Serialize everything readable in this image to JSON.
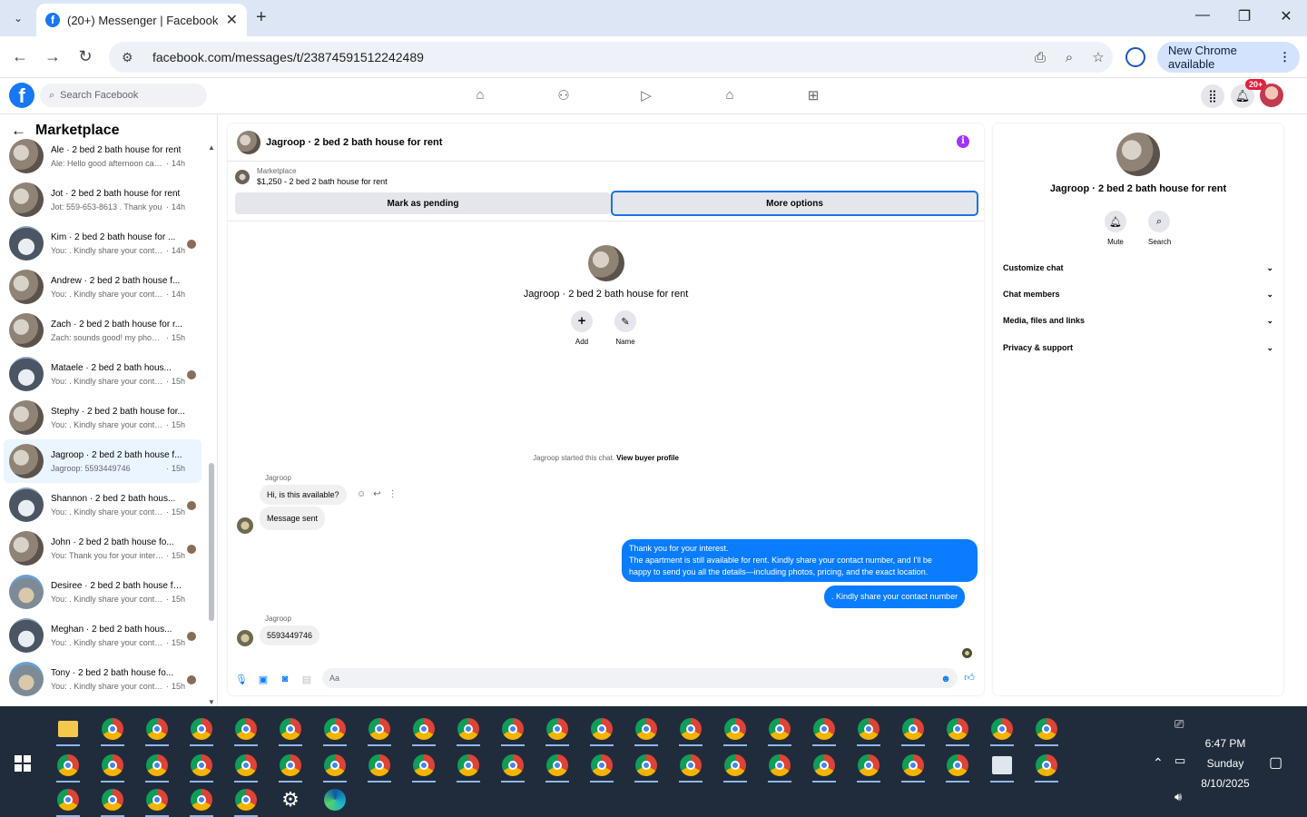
{
  "browser": {
    "tab_title": "(20+) Messenger | Facebook",
    "url": "facebook.com/messages/t/23874591512242489",
    "new_chrome": "New Chrome available"
  },
  "fb": {
    "search_placeholder": "Search Facebook",
    "notif_badge": "20+"
  },
  "left": {
    "title": "Marketplace",
    "conversations": [
      {
        "name": "Ale · 2 bed 2 bath house for rent",
        "preview": "Ale: Hello good afternoon can yo...",
        "time": "14h",
        "seen": false
      },
      {
        "name": "Jot · 2 bed 2 bath house for rent",
        "preview": "Jot: 559-653-8613 . Thank you",
        "time": "14h",
        "seen": false
      },
      {
        "name": "Kim · 2 bed 2 bath house for ...",
        "preview": "You: . Kindly share your conta...",
        "time": "14h",
        "seen": true
      },
      {
        "name": "Andrew · 2 bed 2 bath house f...",
        "preview": "You: . Kindly share your contact ...",
        "time": "14h",
        "seen": false
      },
      {
        "name": "Zach · 2 bed 2 bath house for r...",
        "preview": "Zach: sounds good! my phone n...",
        "time": "15h",
        "seen": false
      },
      {
        "name": "Mataele · 2 bed 2 bath hous...",
        "preview": "You: . Kindly share your conta...",
        "time": "15h",
        "seen": true
      },
      {
        "name": "Stephy · 2 bed 2 bath house for...",
        "preview": "You: . Kindly share your contact ...",
        "time": "15h",
        "seen": false
      },
      {
        "name": "Jagroop · 2 bed 2 bath house f...",
        "preview": "Jagroop: 5593449746",
        "time": "15h",
        "seen": false,
        "active": true
      },
      {
        "name": "Shannon · 2 bed 2 bath hous...",
        "preview": "You: . Kindly share your conta...",
        "time": "15h",
        "seen": true
      },
      {
        "name": "John · 2 bed 2 bath house fo...",
        "preview": "You: Thank you for your intere...",
        "time": "15h",
        "seen": true
      },
      {
        "name": "Desiree · 2 bed 2 bath house fo...",
        "preview": "You: . Kindly share your contact ...",
        "time": "15h",
        "seen": false
      },
      {
        "name": "Meghan · 2 bed 2 bath hous...",
        "preview": "You: . Kindly share your conta...",
        "time": "15h",
        "seen": true
      },
      {
        "name": "Tony · 2 bed 2 bath house fo...",
        "preview": "You: . Kindly share your conta...",
        "time": "15h",
        "seen": true
      }
    ]
  },
  "chat": {
    "title": "Jagroop · 2 bed 2 bath house for rent",
    "marketplace_label": "Marketplace",
    "listing": "$1,250 - 2 bed 2 bath house for rent",
    "mark_pending": "Mark as pending",
    "more_options": "More options",
    "center_name": "Jagroop · 2 bed 2 bath house for rent",
    "add_label": "Add",
    "name_label": "Name",
    "started_text": "Jagroop started this chat.",
    "view_profile": "View buyer profile",
    "sender1": "Jagroop",
    "msg1": "Hi, is this available?",
    "msg2": "Message sent",
    "msg3_l1": "Thank you for your interest.",
    "msg3_l2": "The apartment is still available for rent. Kindly share your contact number, and I'll be",
    "msg3_l3": "happy to send you all the details—including photos, pricing, and the exact location.",
    "msg4": ". Kindly share your contact number",
    "sender2": "Jagroop",
    "msg5": "5593449746",
    "input_placeholder": "Aa"
  },
  "right": {
    "name": "Jagroop · 2 bed 2 bath house for rent",
    "mute": "Mute",
    "search": "Search",
    "sections": [
      "Customize chat",
      "Chat members",
      "Media, files and links",
      "Privacy & support"
    ]
  },
  "taskbar": {
    "time": "6:47 PM",
    "day": "Sunday",
    "date": "8/10/2025"
  }
}
